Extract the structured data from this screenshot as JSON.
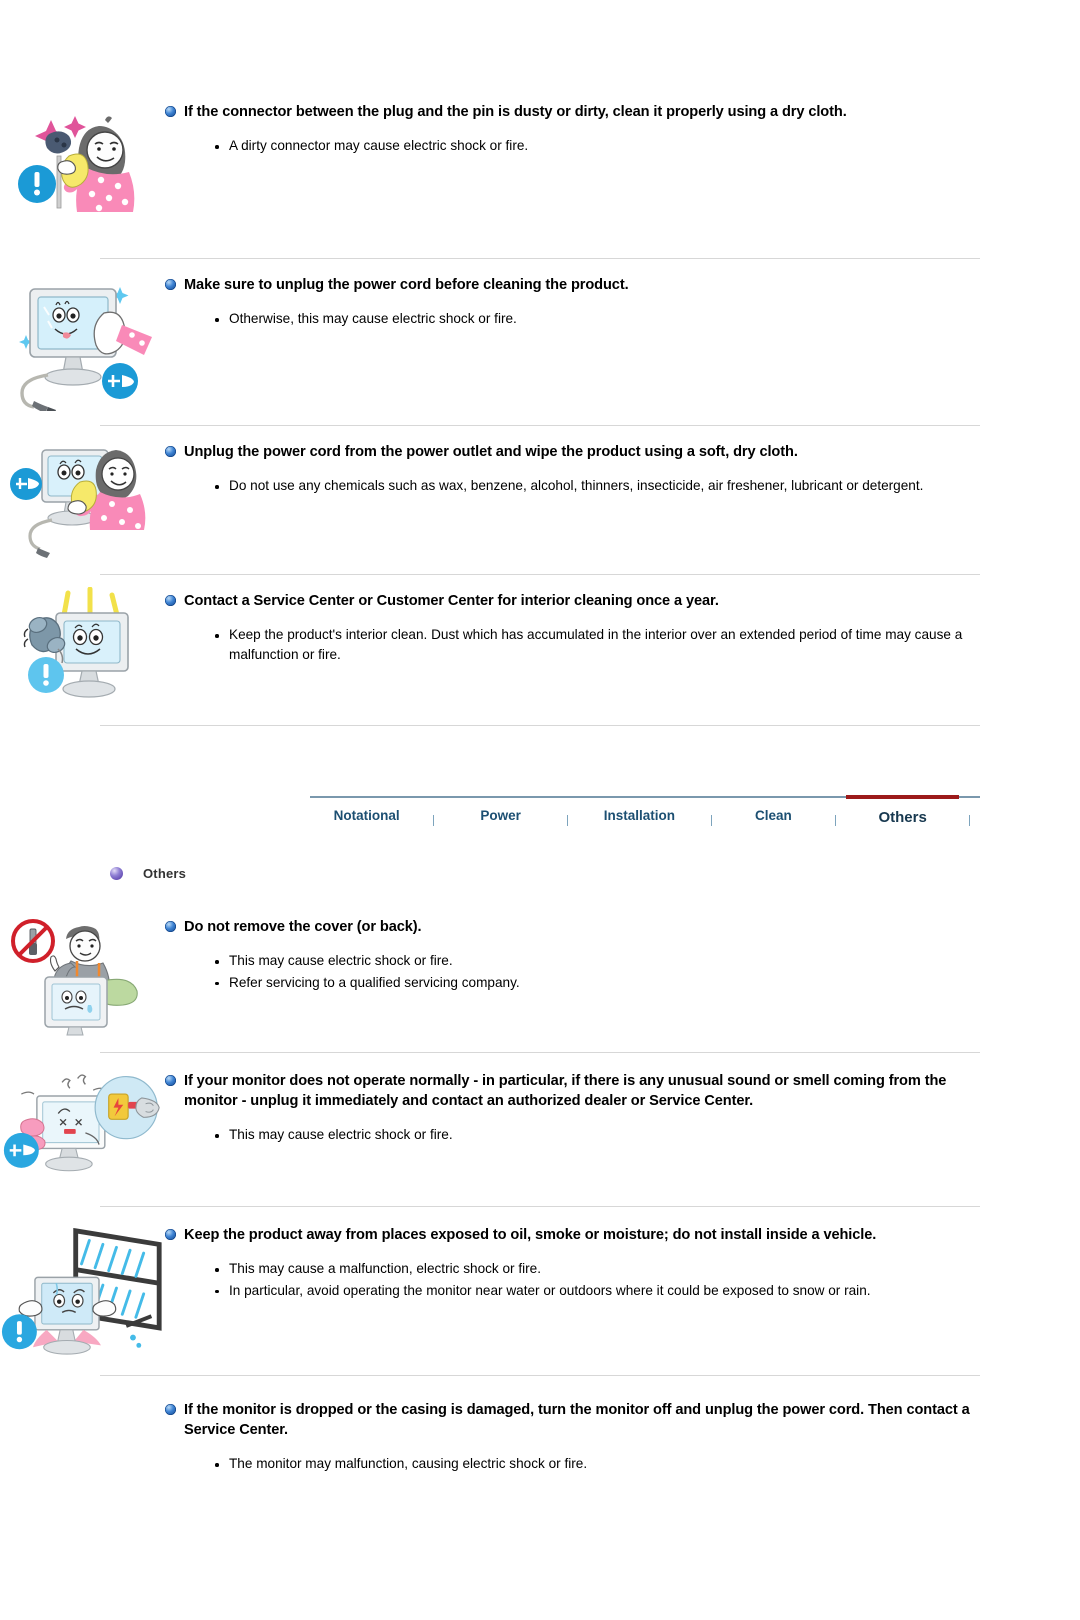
{
  "colors": {
    "heading_bullet": "#0b3f86",
    "tab_text": "#1c4f72",
    "tab_active_underline": "#9c1a1a",
    "tab_rule": "#7a98ad",
    "section_dot": "#4b2fa0",
    "divider": "#d7d7d7",
    "warning_blue": "#1b9ad6",
    "prohibit_red": "#d0202a"
  },
  "clean_section": {
    "items": [
      {
        "icon": "woman-cleaning-plug-illustration",
        "heading": "If the connector between the plug and the pin is dusty or dirty, clean it properly using a dry cloth.",
        "bullets": [
          "A dirty connector may cause electric shock or fire."
        ]
      },
      {
        "icon": "monitor-wipe-unplug-illustration",
        "heading": "Make sure to unplug the power cord before cleaning the product.",
        "bullets": [
          "Otherwise, this may cause electric shock or fire."
        ]
      },
      {
        "icon": "woman-wiping-monitor-illustration",
        "heading": "Unplug the power cord from the power outlet and wipe the product using a soft, dry cloth.",
        "bullets": [
          "Do not use any chemicals such as wax, benzene, alcohol, thinners, insecticide, air freshener, lubricant or detergent."
        ]
      },
      {
        "icon": "monitor-phone-service-illustration",
        "heading": "Contact a Service Center or Customer Center for interior cleaning once a year.",
        "bullets": [
          "Keep the product's interior clean. Dust which has accumulated in the interior over an extended period of time may cause a malfunction or fire."
        ]
      }
    ]
  },
  "tabs": [
    {
      "label": "Notational",
      "active": false
    },
    {
      "label": "Power",
      "active": false
    },
    {
      "label": "Installation",
      "active": false
    },
    {
      "label": "Clean",
      "active": false
    },
    {
      "label": "Others",
      "active": true
    }
  ],
  "section_header": {
    "label": "Others"
  },
  "others_section": {
    "items": [
      {
        "icon": "no-disassembly-repairman-illustration",
        "heading": "Do not remove the cover (or back).",
        "bullets": [
          "This may cause electric shock or fire.",
          "Refer servicing to a qualified servicing company."
        ]
      },
      {
        "icon": "monitor-abnormal-smell-unplug-illustration",
        "heading": "If your monitor does not operate normally - in particular, if there is any unusual sound or smell coming from the monitor - unplug it immediately and contact an authorized dealer or Service Center.",
        "bullets": [
          "This may cause electric shock or fire."
        ]
      },
      {
        "icon": "monitor-rain-window-illustration",
        "heading": "Keep the product away from places exposed to oil, smoke or moisture; do not install inside a vehicle.",
        "bullets": [
          "This may cause a malfunction, electric shock or fire.",
          "In particular, avoid operating the monitor near water or outdoors where it could be exposed to snow or rain."
        ]
      },
      {
        "icon": "none",
        "heading": "If the monitor is dropped or the casing is damaged, turn the monitor off and unplug the power cord. Then contact a Service Center.",
        "bullets": [
          "The monitor may malfunction, causing electric shock or fire."
        ]
      }
    ]
  }
}
